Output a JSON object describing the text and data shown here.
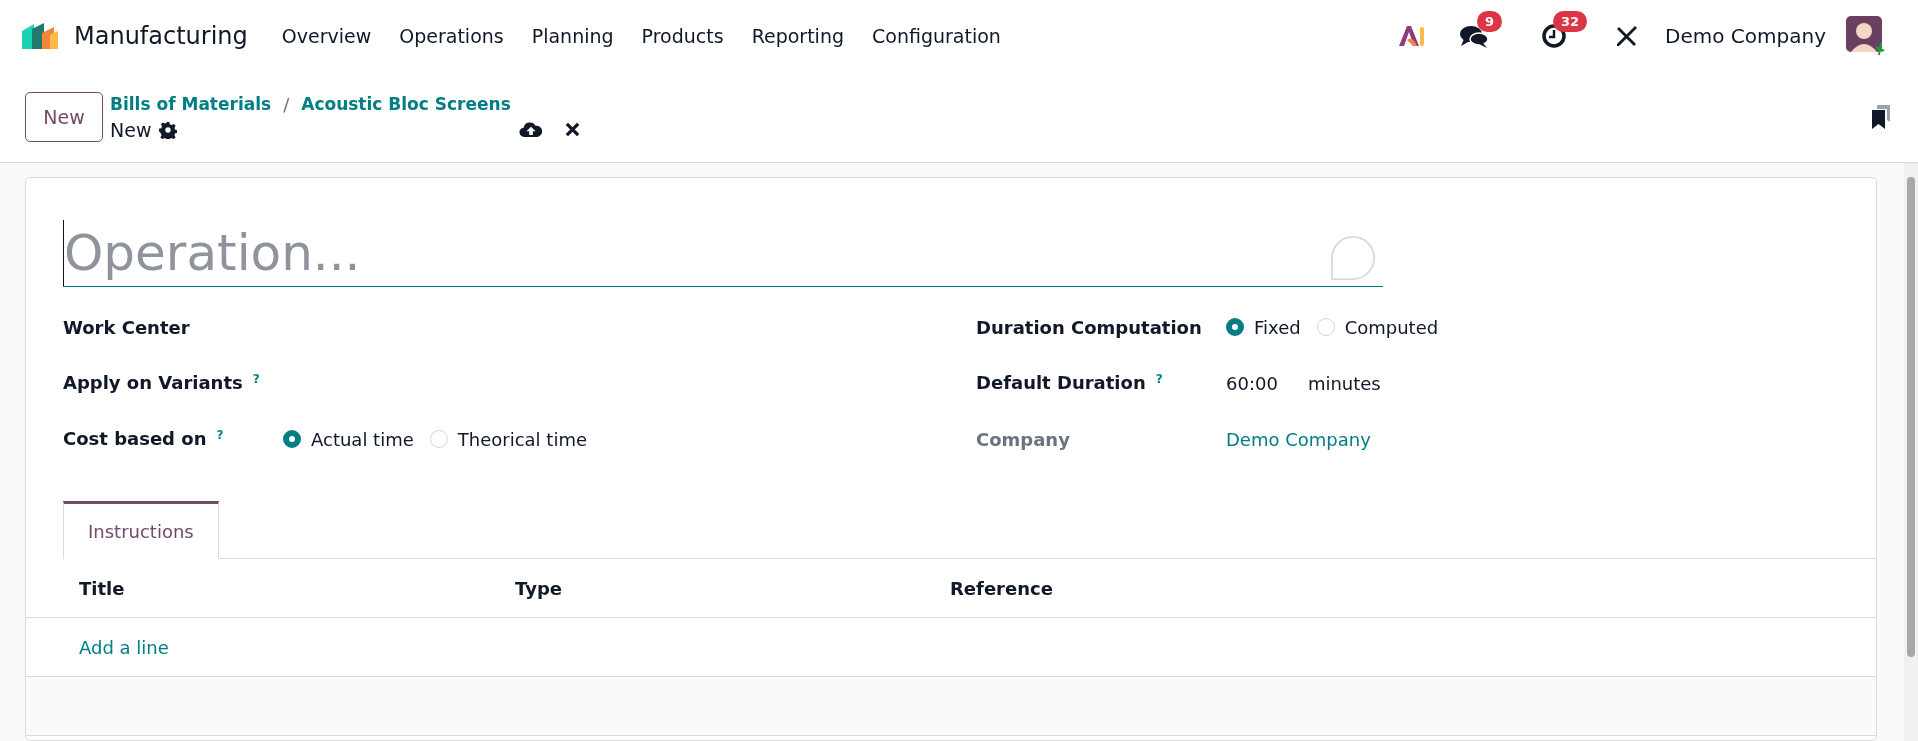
{
  "navbar": {
    "app_name": "Manufacturing",
    "menu": [
      "Overview",
      "Operations",
      "Planning",
      "Products",
      "Reporting",
      "Configuration"
    ],
    "messages_badge": "9",
    "activities_badge": "32",
    "company": "Demo Company"
  },
  "control_panel": {
    "new_button": "New",
    "breadcrumbs": [
      "Bills of Materials",
      "Acoustic Bloc Screens"
    ],
    "breadcrumb_separator": "/",
    "record": "New"
  },
  "form": {
    "name_placeholder": "Operation...",
    "left_fields": [
      {
        "kind": "empty",
        "label": "Work Center"
      },
      {
        "kind": "empty",
        "label": "Apply on Variants",
        "help": "?"
      },
      {
        "kind": "radio",
        "label": "Cost based on",
        "help": "?",
        "options": [
          {
            "label": "Actual time",
            "selected": true
          },
          {
            "label": "Theorical time",
            "selected": false
          }
        ]
      }
    ],
    "right_fields": [
      {
        "kind": "radio",
        "label": "Duration Computation",
        "options": [
          {
            "label": "Fixed",
            "selected": true
          },
          {
            "label": "Computed",
            "selected": false
          }
        ]
      },
      {
        "kind": "duration",
        "label": "Default Duration",
        "help": "?",
        "value": "60:00",
        "unit": "minutes"
      },
      {
        "kind": "link",
        "label": "Company",
        "value": "Demo Company"
      }
    ],
    "tabs": [
      {
        "label": "Instructions",
        "selected": true
      }
    ],
    "table": {
      "columns": [
        "Title",
        "Type",
        "Reference"
      ],
      "add_line": "Add a line"
    }
  }
}
